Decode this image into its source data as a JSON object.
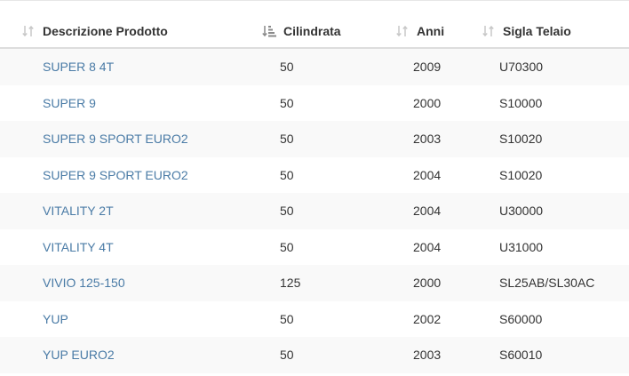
{
  "table": {
    "columns": [
      {
        "label": "Descrizione Prodotto",
        "sort_icon": "sort-both-icon"
      },
      {
        "label": "Cilindrata",
        "sort_icon": "sort-amount-down-icon"
      },
      {
        "label": "Anni",
        "sort_icon": "sort-both-icon"
      },
      {
        "label": "Sigla Telaio",
        "sort_icon": "sort-both-icon"
      }
    ],
    "rows": [
      {
        "description": "SUPER 8 4T",
        "displacement": "50",
        "year": "2009",
        "frame": "U70300"
      },
      {
        "description": "SUPER 9",
        "displacement": "50",
        "year": "2000",
        "frame": "S10000"
      },
      {
        "description": "SUPER 9 SPORT EURO2",
        "displacement": "50",
        "year": "2003",
        "frame": "S10020"
      },
      {
        "description": "SUPER 9 SPORT EURO2",
        "displacement": "50",
        "year": "2004",
        "frame": "S10020"
      },
      {
        "description": "VITALITY 2T",
        "displacement": "50",
        "year": "2004",
        "frame": "U30000"
      },
      {
        "description": "VITALITY 4T",
        "displacement": "50",
        "year": "2004",
        "frame": "U31000"
      },
      {
        "description": "VIVIO 125-150",
        "displacement": "125",
        "year": "2000",
        "frame": "SL25AB/SL30AC"
      },
      {
        "description": "YUP",
        "displacement": "50",
        "year": "2002",
        "frame": "S60000"
      },
      {
        "description": "YUP EURO2",
        "displacement": "50",
        "year": "2003",
        "frame": "S60010"
      }
    ]
  },
  "colors": {
    "link": "#4a7ba6",
    "text": "#333333",
    "stripe": "#f9f9f9",
    "header_border": "#dddddd",
    "sort_inactive": "#c8c8c8",
    "sort_active": "#8a8a8a"
  }
}
